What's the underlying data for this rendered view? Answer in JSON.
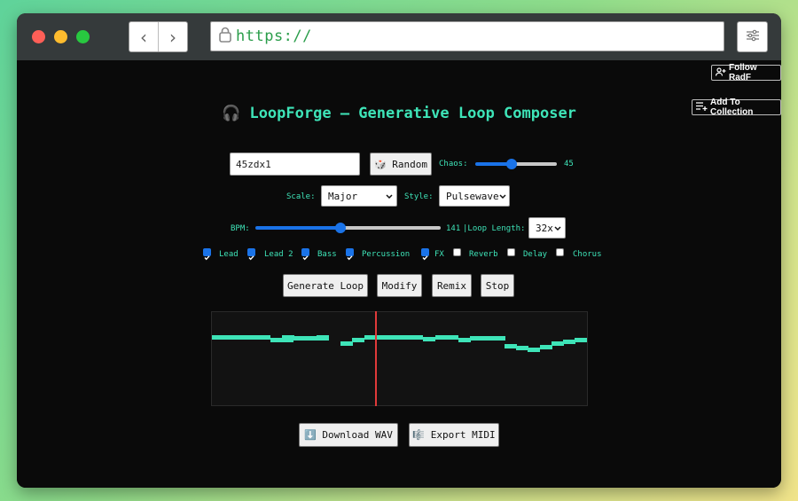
{
  "browser": {
    "url": "https://",
    "dots": [
      "#ff5f57",
      "#febc2e",
      "#28c840"
    ]
  },
  "topbar": {
    "follow": "Follow RadF",
    "collection": "Add To Collection"
  },
  "title": "🎧 LoopForge — Generative Loop Composer",
  "seed": {
    "value": "45zdx1"
  },
  "random_label": "🎲 Random",
  "chaos": {
    "label": "Chaos:",
    "value": "45",
    "fraction": 0.45
  },
  "scale": {
    "label": "Scale:",
    "value": "Major"
  },
  "style": {
    "label": "Style:",
    "value": "Pulsewave"
  },
  "bpm": {
    "label": "BPM:",
    "value": "141",
    "fraction": 0.46
  },
  "loop_length": {
    "label": "|Loop Length:",
    "value": "32x"
  },
  "tracks": [
    {
      "label": "Lead",
      "checked": true
    },
    {
      "label": "Lead 2",
      "checked": true
    },
    {
      "label": "Bass",
      "checked": true
    },
    {
      "label": "Percussion",
      "checked": true
    },
    {
      "label": "FX",
      "checked": true
    },
    {
      "label": "Reverb",
      "checked": false
    },
    {
      "label": "Delay",
      "checked": false
    },
    {
      "label": "Chorus",
      "checked": false
    }
  ],
  "actions": {
    "generate": "Generate Loop",
    "modify": "Modify",
    "remix": "Remix",
    "stop": "Stop"
  },
  "export": {
    "wav": "⬇️ Download WAV",
    "midi": "🎼 Export MIDI"
  },
  "colors": {
    "accent": "#3ee4b8",
    "playhead": "#e03a3a"
  }
}
